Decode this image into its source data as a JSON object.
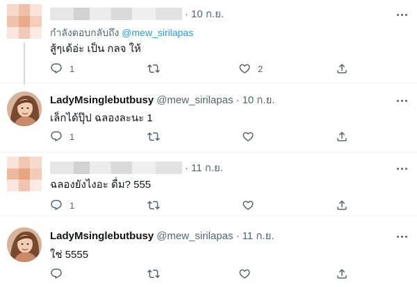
{
  "tweets": [
    {
      "kind": "blurred",
      "display_name": "",
      "handle": "",
      "time": "10 ก.ย.",
      "reply_prefix": "กำลังตอบกลับถึง",
      "reply_handle": "@mew_sirilapas",
      "text": "สู้ๆเด้อ่ะ เป็น กลจ ให้",
      "reply_count": "1",
      "retweet_count": "",
      "like_count": "2"
    },
    {
      "kind": "photo",
      "display_name": "LadyMsinglebutbusy",
      "handle": "@mew_sirilapas",
      "time": "10 ก.ย.",
      "text": "เล็กได้ปุ๊ป ฉลองละนะ 1",
      "reply_count": "1",
      "retweet_count": "",
      "like_count": ""
    },
    {
      "kind": "blurred",
      "display_name": "",
      "handle": "",
      "time": "11 ก.ย.",
      "text": "ฉลองยังไงอะ ดื่ม? 555",
      "reply_count": "1",
      "retweet_count": "",
      "like_count": ""
    },
    {
      "kind": "photo",
      "display_name": "LadyMsinglebutbusy",
      "handle": "@mew_sirilapas",
      "time": "11 ก.ย.",
      "text": "ใช่ 5555",
      "reply_count": "",
      "retweet_count": "",
      "like_count": ""
    }
  ],
  "separator": "·",
  "icons": {
    "reply": "reply-icon",
    "retweet": "retweet-icon",
    "like": "heart-icon",
    "share": "share-icon",
    "more": "more-icon"
  },
  "colors": {
    "text": "#0f1419",
    "muted": "#536471",
    "accent": "#1d9bf0",
    "thread_line": "#cfd9de"
  }
}
